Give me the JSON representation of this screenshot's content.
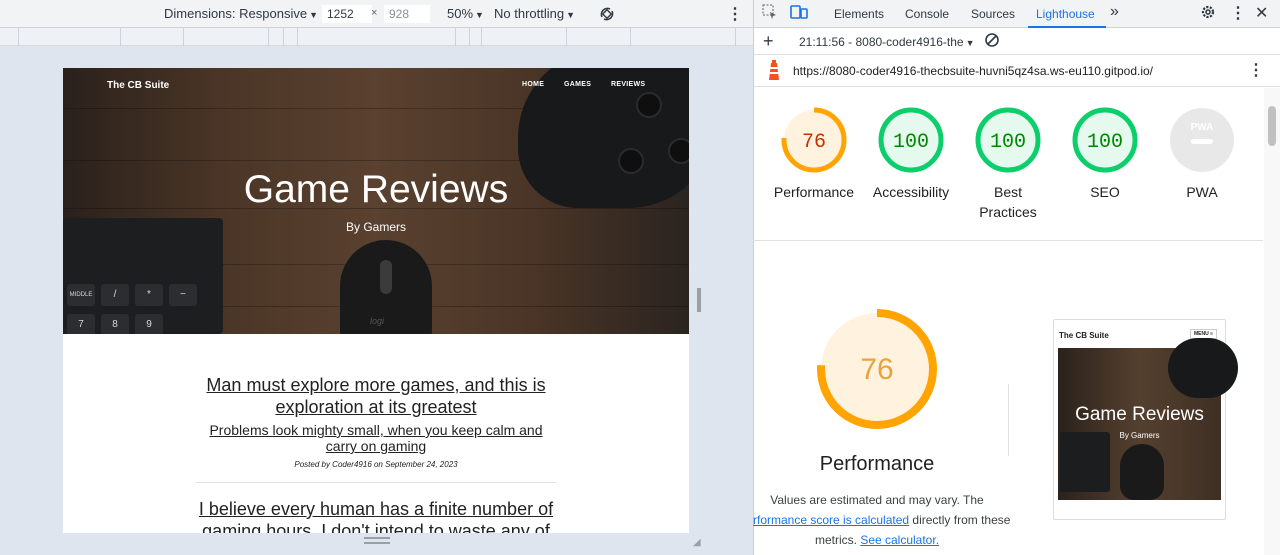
{
  "device_toolbar": {
    "dimensions_label": "Dimensions: Responsive",
    "width_value": "1252",
    "times": "×",
    "height_placeholder": "928",
    "zoom": "50%",
    "throttling": "No throttling",
    "more_icon": "more-vert-icon",
    "rotate_icon": "rotate-icon"
  },
  "site": {
    "brand": "The CB Suite",
    "nav": [
      "HOME",
      "GAMES",
      "REVIEWS"
    ],
    "hero_title": "Game Reviews",
    "hero_subtitle": "By Gamers",
    "keyboard_keys": [
      "MIDDLE",
      "/",
      "*",
      "−",
      "7",
      "8",
      "9"
    ],
    "mouse_brand": "logi",
    "posts": [
      {
        "title_line1": "Man must explore more games, and this is",
        "title_line2": "exploration at its greatest",
        "subtitle_line1": "Problems look mighty small, when you keep calm and",
        "subtitle_line2": "carry on gaming",
        "meta": "Posted by Coder4916 on September 24, 2023"
      },
      {
        "title_line1": "I believe every human has a finite number of",
        "title_line2": "gaming hours. I don't intend to waste any of"
      }
    ]
  },
  "devtools": {
    "tabs": [
      "Elements",
      "Console",
      "Sources",
      "Lighthouse"
    ],
    "active_tab": "Lighthouse",
    "more_tabs": "»",
    "report_label": "21:11:56 - 8080-coder4916-the",
    "url": "https://8080-coder4916-thecbsuite-huvni5qz4sa.ws-eu110.gitpod.io/",
    "categories": [
      {
        "score": "76",
        "label_line1": "Performance",
        "label_line2": "",
        "value": 76,
        "color": "#ffa400",
        "bg": "#fff3e0",
        "text_color": "#c33300"
      },
      {
        "score": "100",
        "label_line1": "Accessibility",
        "label_line2": "",
        "value": 100,
        "color": "#0cce6b",
        "bg": "#e6f9ee",
        "text_color": "#008800"
      },
      {
        "score": "100",
        "label_line1": "Best",
        "label_line2": "Practices",
        "value": 100,
        "color": "#0cce6b",
        "bg": "#e6f9ee",
        "text_color": "#008800"
      },
      {
        "score": "100",
        "label_line1": "SEO",
        "label_line2": "",
        "value": 100,
        "color": "#0cce6b",
        "bg": "#e6f9ee",
        "text_color": "#008800"
      },
      {
        "score": "PWA",
        "label_line1": "PWA",
        "label_line2": "",
        "value": 0,
        "color": "#e0e0e0",
        "bg": "#e8e8e8",
        "text_color": "#ffffff"
      }
    ],
    "perf_big": {
      "score": "76",
      "title": "Performance",
      "desc_1": "Values are estimated and may vary. The",
      "desc_link_1": "rformance score is calculated",
      "desc_2": " directly from these",
      "desc_3": "metrics. ",
      "desc_link_2": "See calculator."
    },
    "thumbnail": {
      "brand": "The CB Suite",
      "menu": "MENU ≡",
      "title": "Game Reviews",
      "subtitle": "By Gamers"
    }
  }
}
